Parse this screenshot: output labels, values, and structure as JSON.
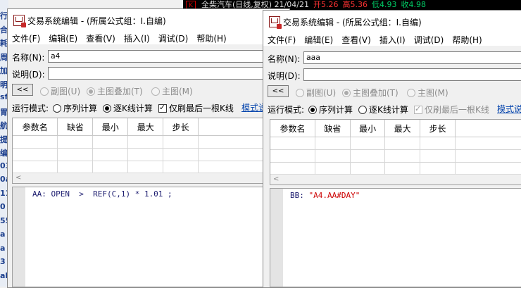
{
  "background": {
    "left_strip": [
      "行",
      "合",
      "耗",
      "周",
      "加",
      "明",
      "sf",
      "胃",
      "航",
      "提",
      "编",
      "03",
      "0a",
      "11",
      "0",
      "55",
      "a",
      "a",
      "3",
      "al"
    ],
    "topbar": {
      "k": "K",
      "text": "全柴汽车(日线,复权) 21/04/21",
      "red1": "开5.26",
      "red2": "高5.36",
      "green1": "低4.93",
      "green2": "收4.98"
    }
  },
  "windows": [
    {
      "id": "left",
      "title": "交易系统编辑 - (所属公式组：I.自编)",
      "menu": [
        "文件(F)",
        "编辑(E)",
        "查看(V)",
        "插入(I)",
        "调试(D)",
        "帮助(H)"
      ],
      "name_label": "名称(N):",
      "name_value": "a4",
      "desc_label": "说明(D):",
      "desc_value": "",
      "collapse_btn": "<<",
      "chart_options": [
        {
          "label": "副图(U)",
          "checked": false
        },
        {
          "label": "主图叠加(T)",
          "checked": true
        },
        {
          "label": "主图(M)",
          "checked": false
        }
      ],
      "run_mode_label": "运行模式:",
      "run_modes": [
        {
          "label": "序列计算",
          "checked": false
        },
        {
          "label": "逐K线计算",
          "checked": true
        }
      ],
      "last_bar_label": "仅刷最后一根K线",
      "last_bar_checked": true,
      "last_bar_disabled": false,
      "template_link": "模式说",
      "param_headers": [
        "参数名",
        "缺省",
        "最小",
        "最大",
        "步长"
      ],
      "code": "AA: OPEN  >  REF(C,1) * 1.01 ;",
      "code_string": ""
    },
    {
      "id": "right",
      "title": "交易系统编辑 - (所属公式组：I.自编)",
      "menu": [
        "文件(F)",
        "编辑(E)",
        "查看(V)",
        "插入(I)",
        "调试(D)",
        "帮助(H)"
      ],
      "name_label": "名称(N):",
      "name_value": "aaa",
      "desc_label": "说明(D):",
      "desc_value": "",
      "collapse_btn": "<<",
      "chart_options": [
        {
          "label": "副图(U)",
          "checked": false
        },
        {
          "label": "主图叠加(T)",
          "checked": true
        },
        {
          "label": "主图(M)",
          "checked": false
        }
      ],
      "run_mode_label": "运行模式:",
      "run_modes": [
        {
          "label": "序列计算",
          "checked": true
        },
        {
          "label": "逐K线计算",
          "checked": false
        }
      ],
      "last_bar_label": "仅刷最后一根K线",
      "last_bar_checked": true,
      "last_bar_disabled": true,
      "template_link": "模式说",
      "param_headers": [
        "参数名",
        "缺省",
        "最小",
        "最大",
        "步长"
      ],
      "code": "BB: ",
      "code_string": "\"A4.AA#DAY\""
    }
  ]
}
